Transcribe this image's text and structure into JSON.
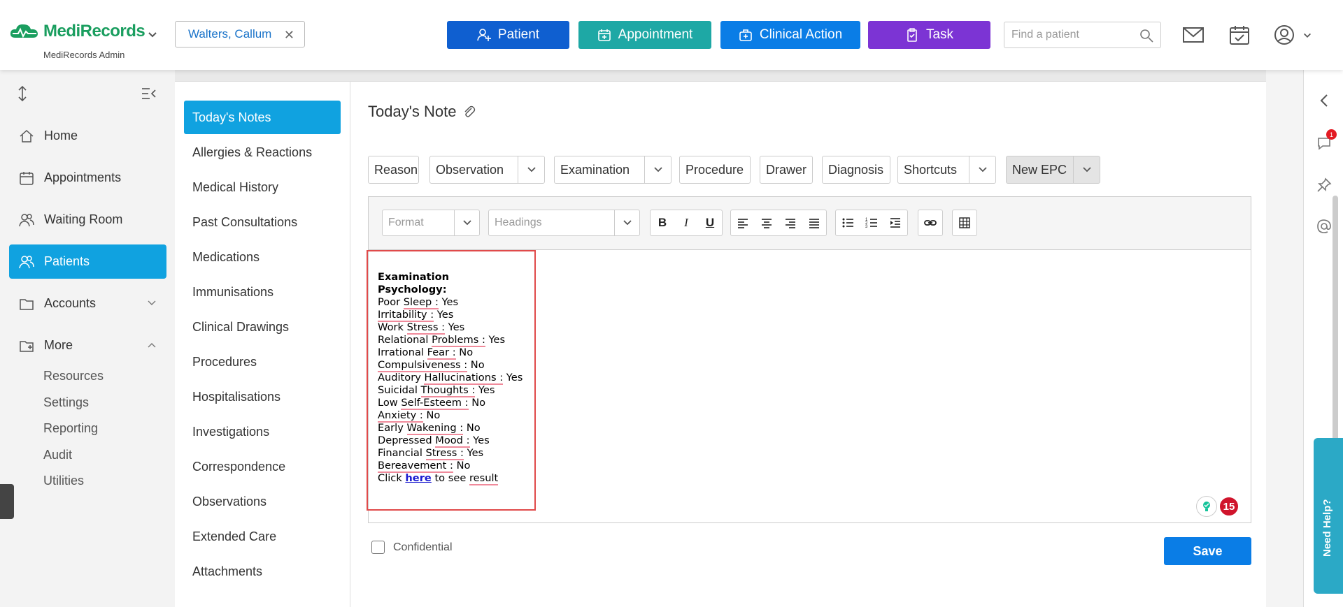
{
  "header": {
    "brand": "MediRecords",
    "brand_sub": "MediRecords Admin",
    "patient_chip": "Walters, Callum",
    "buttons": {
      "patient": "Patient",
      "appointment": "Appointment",
      "clinical_action": "Clinical Action",
      "task": "Task"
    },
    "search_placeholder": "Find a patient"
  },
  "leftnav": {
    "items": [
      {
        "label": "Home"
      },
      {
        "label": "Appointments"
      },
      {
        "label": "Waiting Room"
      },
      {
        "label": "Patients"
      },
      {
        "label": "Accounts"
      },
      {
        "label": "More"
      }
    ],
    "sub_items": [
      "Resources",
      "Settings",
      "Reporting",
      "Audit",
      "Utilities"
    ]
  },
  "sections": [
    "Today's Notes",
    "Allergies & Reactions",
    "Medical History",
    "Past Consultations",
    "Medications",
    "Immunisations",
    "Clinical Drawings",
    "Procedures",
    "Hospitalisations",
    "Investigations",
    "Correspondence",
    "Observations",
    "Extended Care",
    "Attachments"
  ],
  "main": {
    "title": "Today's Note",
    "toolbar": {
      "reason": "Reason",
      "observation": "Observation",
      "examination": "Examination",
      "procedure": "Procedure",
      "drawer": "Drawer",
      "diagnosis": "Diagnosis",
      "shortcuts": "Shortcuts",
      "new_epc": "New EPC"
    },
    "editor": {
      "format_placeholder": "Format",
      "headings_placeholder": "Headings",
      "bold": "B",
      "italic": "I",
      "underline": "U",
      "note": {
        "heading1": "Examination",
        "heading2": "Psychology:",
        "lines": [
          {
            "pre": "Poor ",
            "spell": "Sleep :",
            "post": " Yes"
          },
          {
            "pre": "",
            "spell": "Irritability :",
            "post": " Yes"
          },
          {
            "pre": "Work ",
            "spell": "Stress :",
            "post": " Yes"
          },
          {
            "pre": "Relational ",
            "spell": "Problems :",
            "post": " Yes"
          },
          {
            "pre": "Irrational ",
            "spell": "Fear :",
            "post": " No"
          },
          {
            "pre": "",
            "spell": "Compulsiveness :",
            "post": " No"
          },
          {
            "pre": "Auditory ",
            "spell": "Hallucinations :",
            "post": " Yes"
          },
          {
            "pre": "Suicidal ",
            "spell": "Thoughts :",
            "post": " Yes"
          },
          {
            "pre": "Low ",
            "spell": "Self-Esteem :",
            "post": " No"
          },
          {
            "pre": "",
            "spell": "Anxiety :",
            "post": " No"
          },
          {
            "pre": "Early ",
            "spell": "Wakening :",
            "post": " No"
          },
          {
            "pre": "Depressed ",
            "spell": "Mood :",
            "post": " Yes"
          },
          {
            "pre": "Financial ",
            "spell": "Stress :",
            "post": " Yes"
          },
          {
            "pre": "",
            "spell": "Bereavement :",
            "post": " No"
          }
        ],
        "click_pre": "Click ",
        "click_link": "here",
        "click_mid": " to see ",
        "click_end": "result"
      },
      "issue_count": "15"
    },
    "confidential_label": "Confidential",
    "save_label": "Save"
  },
  "rightrail": {
    "notification_count": "1",
    "need_help": "Need Help?"
  },
  "colors": {
    "primary_blue": "#0a7de6",
    "nav_active": "#10a2e0",
    "appointment_teal": "#1ea8a5",
    "task_purple": "#7c34d4",
    "patient_blue": "#0f5fd0"
  }
}
